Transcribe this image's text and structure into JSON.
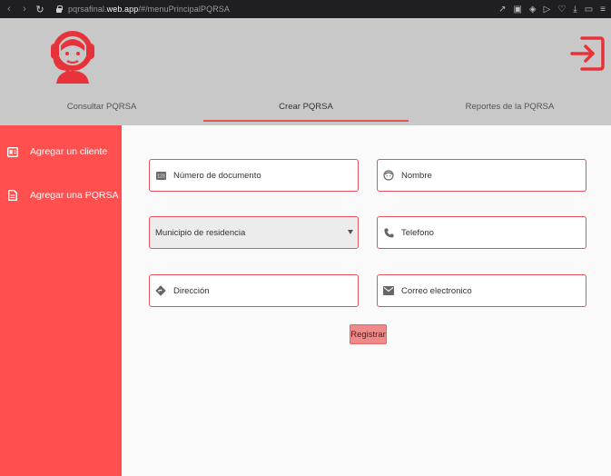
{
  "browser": {
    "url_prefix": "pqrsafinal.",
    "url_domain": "web.app",
    "url_path": "/#/menuPrincipalPQRSA"
  },
  "header": {
    "tabs": [
      {
        "label": "Consultar PQRSA"
      },
      {
        "label": "Crear PQRSA",
        "active": true
      },
      {
        "label": "Reportes de la PQRSA"
      }
    ]
  },
  "sidebar": {
    "items": [
      {
        "label": "Agregar un cliente",
        "icon": "contact-card-icon"
      },
      {
        "label": "Agregar una PQRSA",
        "icon": "document-icon"
      }
    ]
  },
  "form": {
    "document_placeholder": "Número de documento",
    "name_placeholder": "Nombre",
    "municipality_value": "Municipio de residencia",
    "phone_placeholder": "Telefono",
    "address_placeholder": "Dirección",
    "email_placeholder": "Correo electronico",
    "submit_label": "Registrar"
  },
  "colors": {
    "accent": "#ff4f4f",
    "header_bg": "#c8c8c8",
    "logo": "#e8323a"
  }
}
